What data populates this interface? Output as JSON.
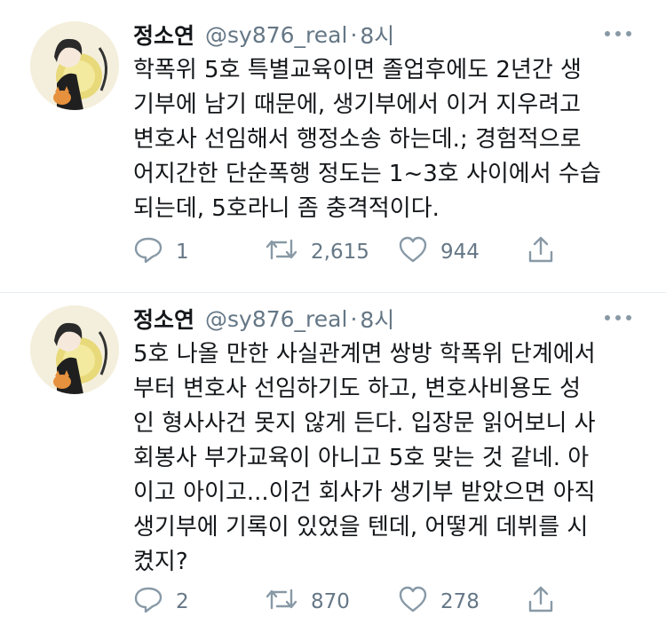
{
  "tweets": [
    {
      "name": "정소연",
      "handle": "@sy876_real",
      "separator": "·",
      "time": "8시",
      "text": "학폭위 5호 특별교육이면 졸업후에도 2년간 생\n기부에 남기 때문에, 생기부에서 이거 지우려고\n변호사 선임해서 행정소송 하는데.; 경험적으로\n어지간한 단순폭행 정도는 1~3호 사이에서 수습\n되는데, 5호라니 좀 충격적이다.",
      "replies": "1",
      "retweets": "2,615",
      "likes": "944"
    },
    {
      "name": "정소연",
      "handle": "@sy876_real",
      "separator": "·",
      "time": "8시",
      "text": "5호 나올 만한 사실관계면 쌍방 학폭위 단계에서\n부터 변호사 선임하기도 하고, 변호사비용도 성\n인 형사사건 못지 않게 든다. 입장문 읽어보니 사\n회봉사 부가교육이 아니고 5호 맞는 것 같네. 아\n이고 아이고...이건 회사가 생기부 받았으면 아직\n생기부에 기록이 있었을 텐데, 어떻게 데뷔를 시\n켰지?",
      "replies": "2",
      "retweets": "870",
      "likes": "278"
    }
  ],
  "icons": {
    "reply": "reply-icon",
    "retweet": "retweet-icon",
    "like": "heart-icon",
    "share": "share-icon",
    "more": "more-icon"
  },
  "colors": {
    "text": "#14171a",
    "muted": "#657786",
    "divider": "#e6ecf0"
  }
}
